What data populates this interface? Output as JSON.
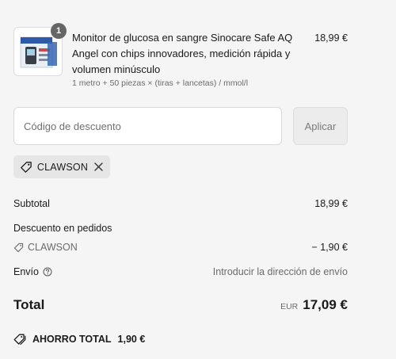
{
  "product": {
    "title": "Monitor de glucosa en sangre Sinocare Safe AQ Angel con chips innovadores, medición rápida y volumen minúsculo",
    "variant": "1 metro + 50 piezas × (tiras + lancetas) / mmol/l",
    "price": "18,99 €",
    "quantity": "1",
    "image_icon": "glucose-monitor-box"
  },
  "discount": {
    "placeholder": "Código de descuento",
    "value": "",
    "apply_label": "Aplicar",
    "applied_code": "CLAWSON"
  },
  "summary": {
    "subtotal_label": "Subtotal",
    "subtotal_value": "18,99 €",
    "order_discount_label": "Descuento en pedidos",
    "order_discount_code": "CLAWSON",
    "order_discount_value": "− 1,90 €",
    "shipping_label": "Envío",
    "shipping_value": "Introducir la dirección de envío",
    "total_label": "Total",
    "currency": "EUR",
    "total_value": "17,09 €",
    "savings_label": "AHORRO TOTAL",
    "savings_value": "1,90 €"
  },
  "colors": {
    "background": "#f5f5f5",
    "text": "#1a1a1a",
    "muted": "#6b6b6b",
    "chip": "#e6e6e6"
  }
}
